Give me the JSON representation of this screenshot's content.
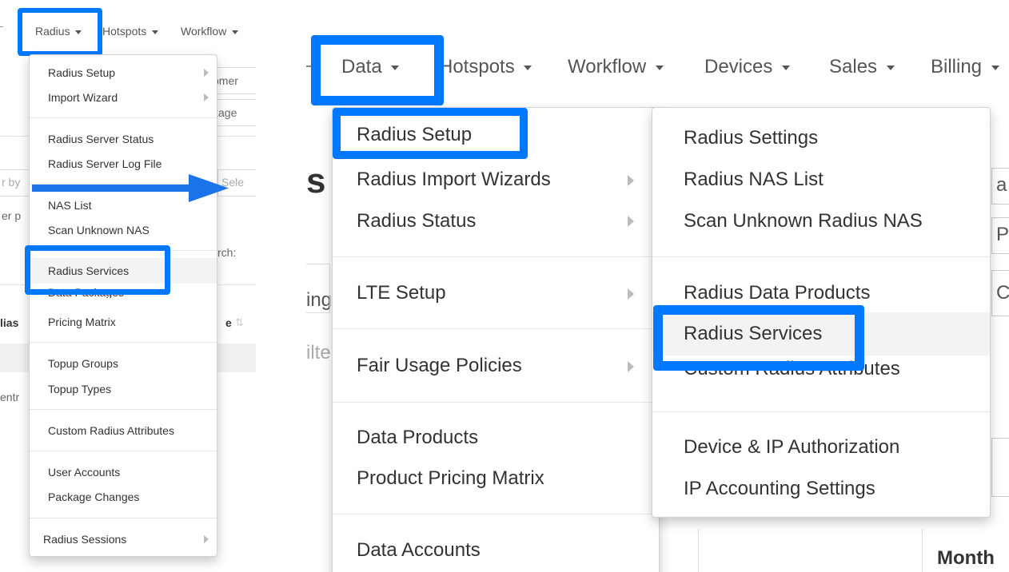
{
  "left": {
    "nav": {
      "radius": "Radius",
      "hotspots": "Hotspots",
      "workflow": "Workflow"
    },
    "background": {
      "tomer": "omer",
      "kage": "kage",
      "sele": "Sele",
      "filter_by": "r by",
      "per": "er p",
      "search": "rch:",
      "alias": "lias",
      "e_label": "e",
      "entr": "entr"
    },
    "menu": {
      "radius_setup": "Radius Setup",
      "import_wizard": "Import Wizard",
      "radius_server_status": "Radius Server Status",
      "radius_server_log_file": "Radius Server Log File",
      "nas_list": "NAS List",
      "scan_unknown_nas": "Scan Unknown NAS",
      "radius_services": "Radius Services",
      "data_packages": "Data Packages",
      "pricing_matrix": "Pricing Matrix",
      "topup_groups": "Topup Groups",
      "topup_types": "Topup Types",
      "custom_radius_attributes": "Custom Radius Attributes",
      "user_accounts": "User Accounts",
      "package_changes": "Package Changes",
      "radius_sessions": "Radius Sessions"
    }
  },
  "right": {
    "nav": {
      "data": "Data",
      "hotspots": "Hotspots",
      "workflow": "Workflow",
      "devices": "Devices",
      "sales": "Sales",
      "billing": "Billing"
    },
    "background": {
      "s": "s",
      "ing": "ing",
      "ilte": "ilte",
      "a": "a",
      "p": "P",
      "c": "C",
      "month": "Month"
    },
    "menu": {
      "radius_setup": "Radius Setup",
      "radius_import_wizards": "Radius Import Wizards",
      "radius_status": "Radius Status",
      "lte_setup": "LTE Setup",
      "fair_usage_policies": "Fair Usage Policies",
      "data_products": "Data Products",
      "product_pricing_matrix": "Product Pricing Matrix",
      "data_accounts": "Data Accounts"
    },
    "submenu": {
      "radius_settings": "Radius Settings",
      "radius_nas_list": "Radius NAS List",
      "scan_unknown_radius_nas": "Scan Unknown Radius NAS",
      "radius_data_products": "Radius Data Products",
      "radius_services": "Radius Services",
      "custom_radius_attributes": "Custom Radius Attributes",
      "device_ip_authorization": "Device & IP Authorization",
      "ip_accounting_settings": "IP Accounting Settings"
    }
  },
  "colors": {
    "highlight": "#0078ff",
    "arrow": "#1a73e8"
  }
}
